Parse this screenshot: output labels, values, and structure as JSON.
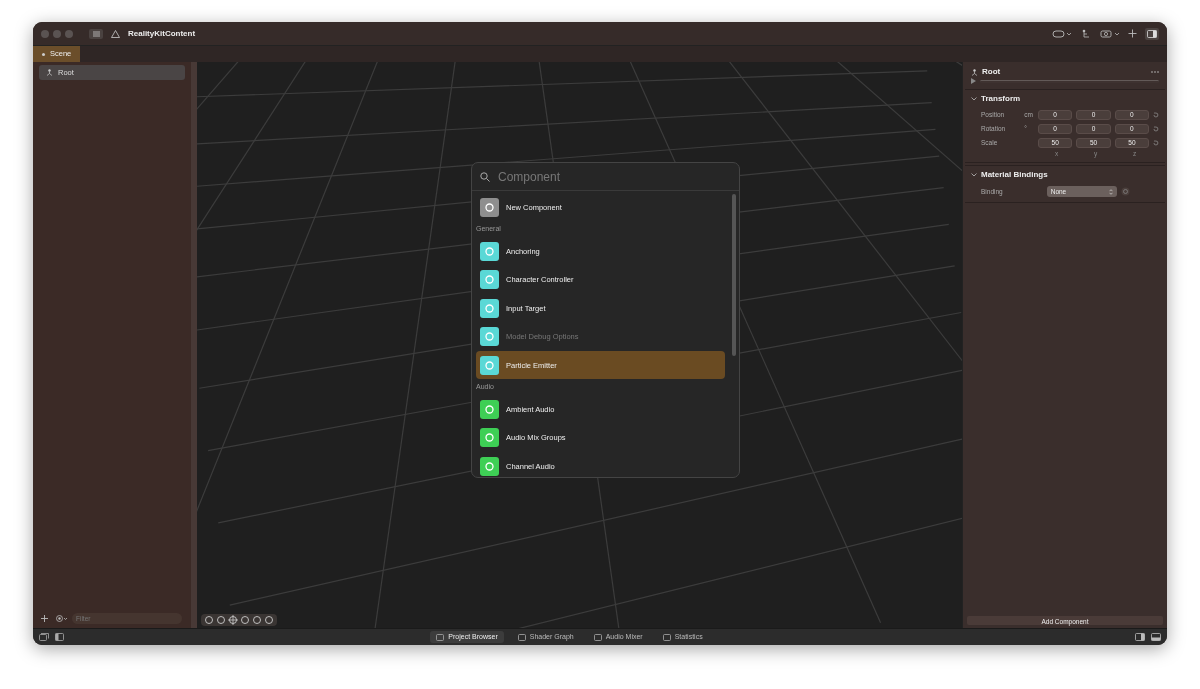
{
  "window": {
    "title": "RealityKitContent"
  },
  "scene_tab": {
    "label": "Scene",
    "selected": true
  },
  "outline": {
    "items": [
      {
        "label": "Root",
        "selected": true
      }
    ]
  },
  "filter": {
    "placeholder": "Filter"
  },
  "component_picker": {
    "search_placeholder": "Component",
    "items": [
      {
        "kind": "item",
        "label": "New Component",
        "color": "#8e8e8e",
        "disabled": false,
        "selected": false
      },
      {
        "kind": "header",
        "label": "General"
      },
      {
        "kind": "item",
        "label": "Anchoring",
        "color": "#5ad8d6",
        "disabled": false,
        "selected": false
      },
      {
        "kind": "item",
        "label": "Character Controller",
        "color": "#5ad8d6",
        "disabled": false,
        "selected": false
      },
      {
        "kind": "item",
        "label": "Input Target",
        "color": "#5ad8d6",
        "disabled": false,
        "selected": false
      },
      {
        "kind": "item",
        "label": "Model Debug Options",
        "color": "#5ad8d6",
        "disabled": true,
        "selected": false
      },
      {
        "kind": "item",
        "label": "Particle Emitter",
        "color": "#5ad8d6",
        "disabled": false,
        "selected": true
      },
      {
        "kind": "header",
        "label": "Audio"
      },
      {
        "kind": "item",
        "label": "Ambient Audio",
        "color": "#3ecf55",
        "disabled": false,
        "selected": false
      },
      {
        "kind": "item",
        "label": "Audio Mix Groups",
        "color": "#3ecf55",
        "disabled": false,
        "selected": false
      },
      {
        "kind": "item",
        "label": "Channel Audio",
        "color": "#3ecf55",
        "disabled": false,
        "selected": false
      }
    ]
  },
  "inspector": {
    "entity": "Root",
    "sections": [
      {
        "kind": "transform",
        "title": "Transform",
        "expanded": true,
        "rows": [
          {
            "label": "Position",
            "unit": "cm",
            "values": [
              "0",
              "0",
              "0"
            ]
          },
          {
            "label": "Rotation",
            "unit": "°",
            "values": [
              "0",
              "0",
              "0"
            ]
          },
          {
            "label": "Scale",
            "values": [
              "50",
              "50",
              "50"
            ]
          }
        ],
        "axes": [
          "x",
          "y",
          "z"
        ]
      },
      {
        "kind": "binding",
        "title": "Material Bindings",
        "expanded": true,
        "label": "Binding",
        "value": "None"
      }
    ],
    "add_button": "Add Component"
  },
  "bottom_tabs": [
    {
      "label": "Project Browser",
      "selected": true
    },
    {
      "label": "Shader Graph",
      "selected": false
    },
    {
      "label": "Audio Mixer",
      "selected": false
    },
    {
      "label": "Statistics",
      "selected": false
    }
  ]
}
